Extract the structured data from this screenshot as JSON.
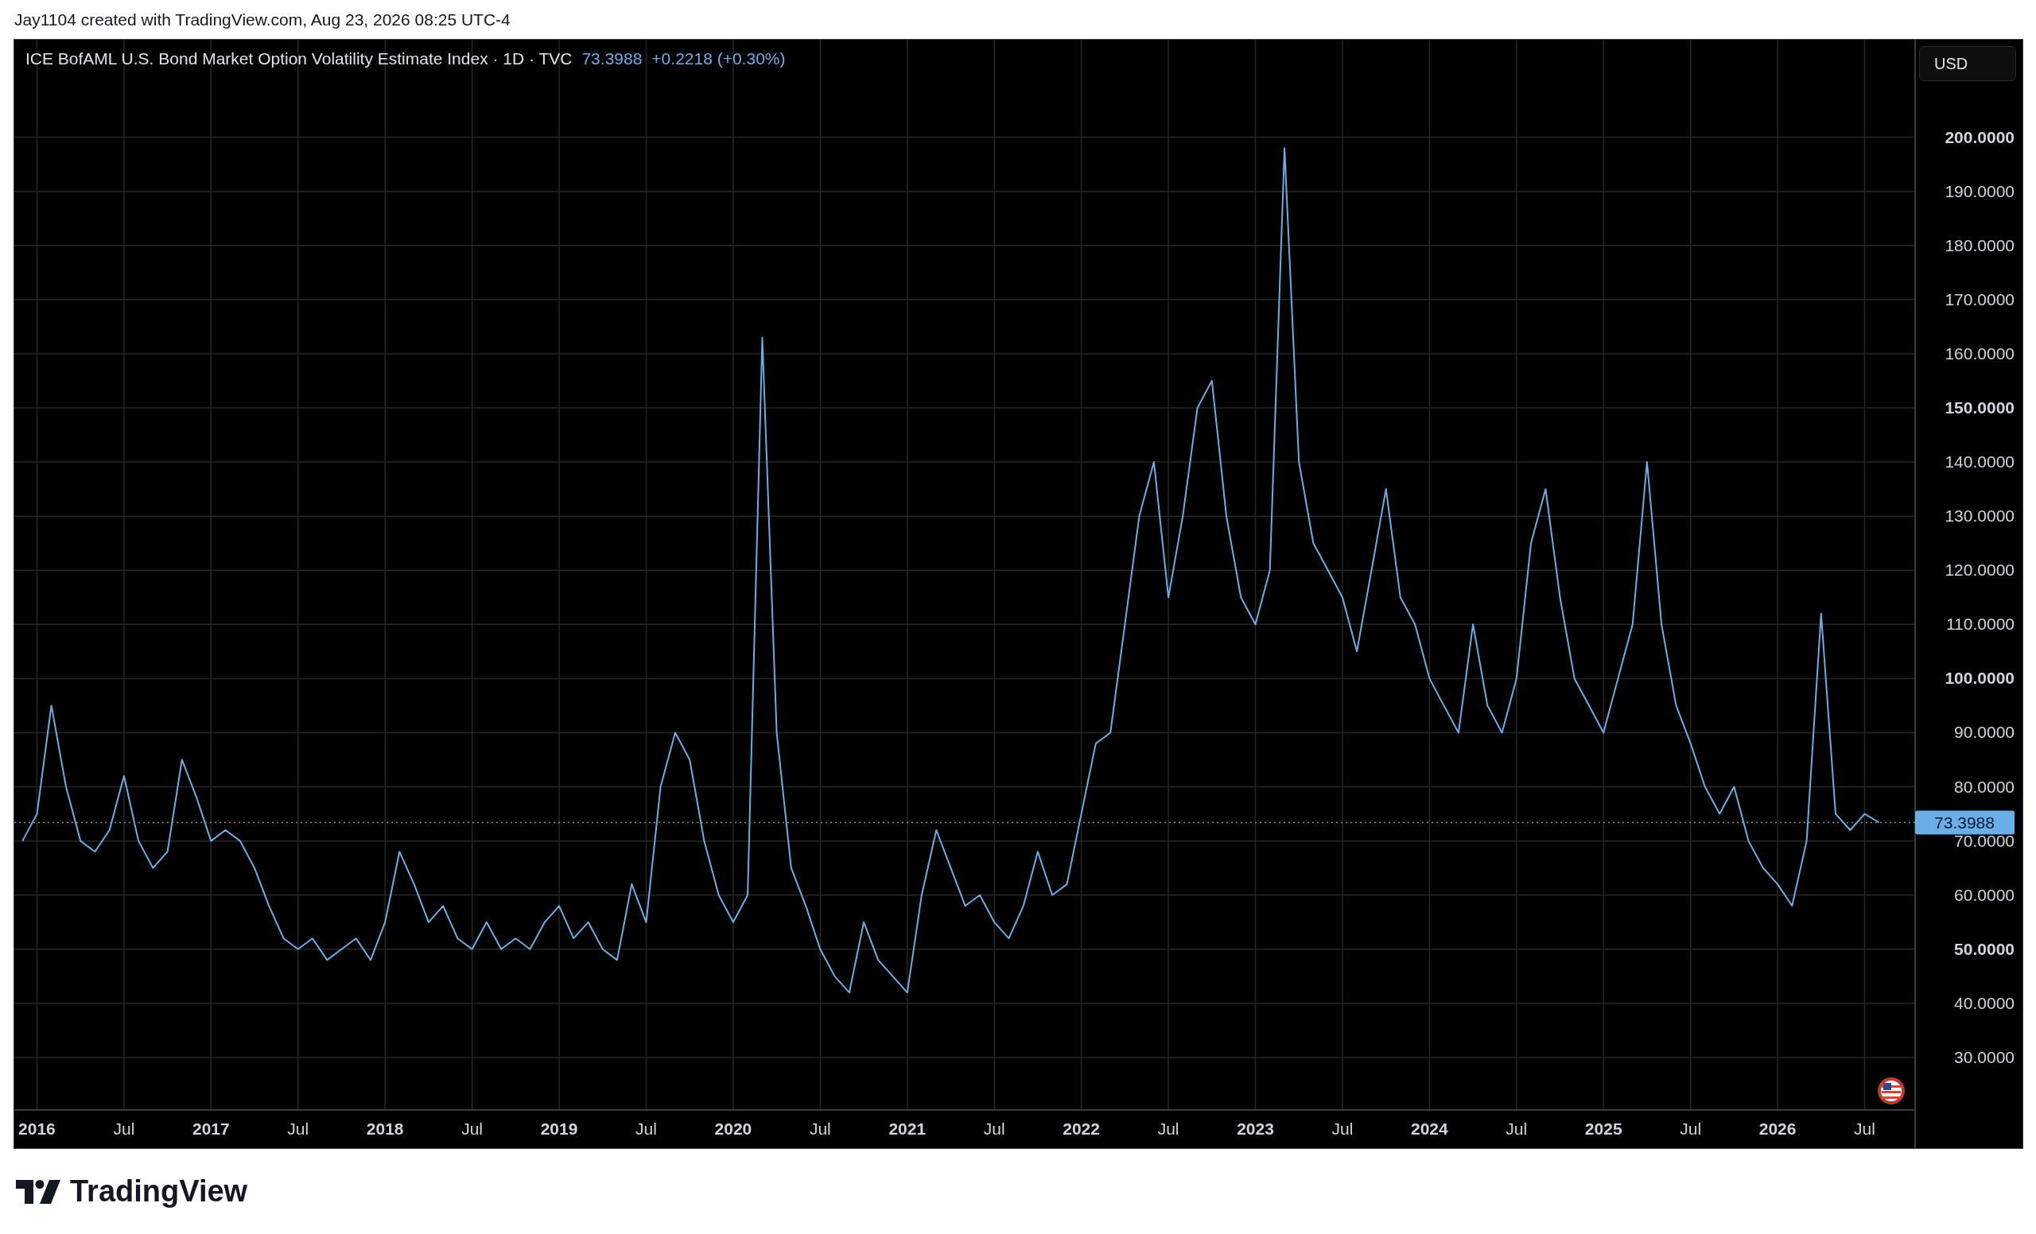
{
  "attribution": "Jay1104 created with TradingView.com, Aug 23, 2026 08:25 UTC-4",
  "legend": {
    "title": "ICE BofAML U.S. Bond Market Option Volatility Estimate Index · 1D · TVC",
    "price": "73.3988",
    "change": "+0.2218 (+0.30%)"
  },
  "currency_button": "USD",
  "chart_data": {
    "type": "line",
    "x": [
      2015.917,
      2016,
      2016.083,
      2016.167,
      2016.25,
      2016.333,
      2016.417,
      2016.5,
      2016.583,
      2016.667,
      2016.75,
      2016.833,
      2016.917,
      2017,
      2017.083,
      2017.167,
      2017.25,
      2017.333,
      2017.417,
      2017.5,
      2017.583,
      2017.667,
      2017.75,
      2017.833,
      2017.917,
      2018,
      2018.083,
      2018.167,
      2018.25,
      2018.333,
      2018.417,
      2018.5,
      2018.583,
      2018.667,
      2018.75,
      2018.833,
      2018.917,
      2019,
      2019.083,
      2019.167,
      2019.25,
      2019.333,
      2019.417,
      2019.5,
      2019.583,
      2019.667,
      2019.75,
      2019.833,
      2019.917,
      2020,
      2020.083,
      2020.167,
      2020.25,
      2020.333,
      2020.417,
      2020.5,
      2020.583,
      2020.667,
      2020.75,
      2020.833,
      2020.917,
      2021,
      2021.083,
      2021.167,
      2021.25,
      2021.333,
      2021.417,
      2021.5,
      2021.583,
      2021.667,
      2021.75,
      2021.833,
      2021.917,
      2022,
      2022.083,
      2022.167,
      2022.25,
      2022.333,
      2022.417,
      2022.5,
      2022.583,
      2022.667,
      2022.75,
      2022.833,
      2022.917,
      2023,
      2023.083,
      2023.167,
      2023.25,
      2023.333,
      2023.417,
      2023.5,
      2023.583,
      2023.667,
      2023.75,
      2023.833,
      2023.917,
      2024,
      2024.083,
      2024.167,
      2024.25,
      2024.333,
      2024.417,
      2024.5,
      2024.583,
      2024.667,
      2024.75,
      2024.833,
      2024.917,
      2025,
      2025.083,
      2025.167,
      2025.25,
      2025.333,
      2025.417,
      2025.5,
      2025.583,
      2025.667,
      2025.75,
      2025.833,
      2025.917,
      2026,
      2026.083,
      2026.167,
      2026.25,
      2026.333,
      2026.417,
      2026.5,
      2026.583
    ],
    "series": [
      {
        "color": "#6aaee8",
        "values": [
          70,
          75,
          95,
          80,
          70,
          68,
          72,
          82,
          70,
          65,
          68,
          85,
          78,
          70,
          72,
          70,
          65,
          58,
          52,
          50,
          52,
          48,
          50,
          52,
          48,
          55,
          68,
          62,
          55,
          58,
          52,
          50,
          55,
          50,
          52,
          50,
          55,
          58,
          52,
          55,
          50,
          48,
          62,
          55,
          80,
          90,
          85,
          70,
          60,
          55,
          60,
          163,
          90,
          65,
          58,
          50,
          45,
          42,
          55,
          48,
          45,
          42,
          60,
          72,
          65,
          58,
          60,
          55,
          52,
          58,
          68,
          60,
          62,
          75,
          88,
          90,
          110,
          130,
          140,
          115,
          130,
          150,
          155,
          130,
          115,
          110,
          120,
          198,
          140,
          125,
          120,
          115,
          105,
          120,
          135,
          115,
          110,
          100,
          95,
          90,
          110,
          95,
          90,
          100,
          125,
          135,
          115,
          100,
          95,
          90,
          100,
          110,
          140,
          110,
          95,
          88,
          80,
          75,
          80,
          70,
          65,
          62,
          58,
          70,
          112,
          75,
          72,
          75,
          73.4
        ]
      }
    ],
    "xlim": [
      2015.87,
      2026.79
    ],
    "ylim": [
      20.3,
      218
    ],
    "xticks": [
      {
        "value": 2016,
        "label": "2016"
      },
      {
        "value": 2016.5,
        "label": "Jul"
      },
      {
        "value": 2017,
        "label": "2017"
      },
      {
        "value": 2017.5,
        "label": "Jul"
      },
      {
        "value": 2018,
        "label": "2018"
      },
      {
        "value": 2018.5,
        "label": "Jul"
      },
      {
        "value": 2019,
        "label": "2019"
      },
      {
        "value": 2019.5,
        "label": "Jul"
      },
      {
        "value": 2020,
        "label": "2020"
      },
      {
        "value": 2020.5,
        "label": "Jul"
      },
      {
        "value": 2021,
        "label": "2021"
      },
      {
        "value": 2021.5,
        "label": "Jul"
      },
      {
        "value": 2022,
        "label": "2022"
      },
      {
        "value": 2022.5,
        "label": "Jul"
      },
      {
        "value": 2023,
        "label": "2023"
      },
      {
        "value": 2023.5,
        "label": "Jul"
      },
      {
        "value": 2024,
        "label": "2024"
      },
      {
        "value": 2024.5,
        "label": "Jul"
      },
      {
        "value": 2025,
        "label": "2025"
      },
      {
        "value": 2025.5,
        "label": "Jul"
      },
      {
        "value": 2026,
        "label": "2026"
      },
      {
        "value": 2026.5,
        "label": "Jul"
      }
    ],
    "yticks": [
      {
        "value": 30,
        "label": "30.0000"
      },
      {
        "value": 40,
        "label": "40.0000"
      },
      {
        "value": 50,
        "label": "50.0000"
      },
      {
        "value": 60,
        "label": "60.0000"
      },
      {
        "value": 70,
        "label": "70.0000"
      },
      {
        "value": 80,
        "label": "80.0000"
      },
      {
        "value": 90,
        "label": "90.0000"
      },
      {
        "value": 100,
        "label": "100.0000"
      },
      {
        "value": 110,
        "label": "110.0000"
      },
      {
        "value": 120,
        "label": "120.0000"
      },
      {
        "value": 130,
        "label": "130.0000"
      },
      {
        "value": 140,
        "label": "140.0000"
      },
      {
        "value": 150,
        "label": "150.0000"
      },
      {
        "value": 160,
        "label": "160.0000"
      },
      {
        "value": 170,
        "label": "170.0000"
      },
      {
        "value": 180,
        "label": "180.0000"
      },
      {
        "value": 190,
        "label": "190.0000"
      },
      {
        "value": 200,
        "label": "200.0000"
      }
    ],
    "grid": true,
    "ref_lines": [
      {
        "axis": "y",
        "value": 73.3988,
        "label": "73.3988",
        "color": "#8a8a8a"
      }
    ]
  },
  "footer": {
    "logo_text": "TradingView"
  }
}
